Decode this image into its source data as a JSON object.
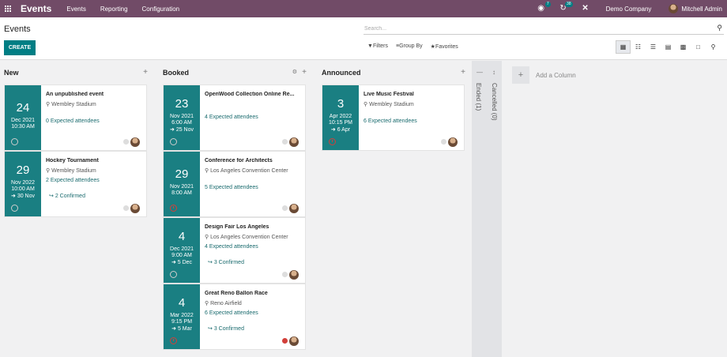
{
  "topbar": {
    "brand": "Events",
    "menu": [
      "Events",
      "Reporting",
      "Configuration"
    ],
    "chat_badge": "7",
    "activity_badge": "38",
    "company": "Demo Company",
    "user": "Mitchell Admin"
  },
  "control": {
    "title": "Events",
    "create_label": "CREATE",
    "search_placeholder": "Search...",
    "filters_label": "Filters",
    "groupby_label": "Group By",
    "favorites_label": "Favorites"
  },
  "columns": [
    {
      "name": "New",
      "cards": [
        {
          "day": "24",
          "month_year": "Dec 2021",
          "time": "10:30 AM",
          "end": "",
          "title": "An unpublished event",
          "location": "Wembley Stadium",
          "attendees": "0 Expected attendees",
          "confirmed": "",
          "clock": "grey",
          "dot": "grey"
        },
        {
          "day": "29",
          "month_year": "Nov 2022",
          "time": "10:00 AM",
          "end": "30 Nov",
          "title": "Hockey Tournament",
          "location": "Wembley Stadium",
          "attendees": "2 Expected attendees",
          "confirmed": "2 Confirmed",
          "clock": "grey",
          "dot": "grey"
        }
      ]
    },
    {
      "name": "Booked",
      "cards": [
        {
          "day": "23",
          "month_year": "Nov 2021",
          "time": "6:00 AM",
          "end": "25 Nov",
          "title": "OpenWood Collection Online Re...",
          "location": "",
          "attendees": "4 Expected attendees",
          "confirmed": "",
          "clock": "grey",
          "dot": "grey"
        },
        {
          "day": "29",
          "month_year": "Nov 2021",
          "time": "8:00 AM",
          "end": "",
          "title": "Conference for Architects",
          "location": "Los Angeles Convention Center",
          "attendees": "5 Expected attendees",
          "confirmed": "",
          "clock": "red",
          "dot": "grey"
        },
        {
          "day": "4",
          "month_year": "Dec 2021",
          "time": "9:00 AM",
          "end": "5 Dec",
          "title": "Design Fair Los Angeles",
          "location": "Los Angeles Convention Center",
          "attendees": "4 Expected attendees",
          "confirmed": "3 Confirmed",
          "clock": "grey",
          "dot": "grey"
        },
        {
          "day": "4",
          "month_year": "Mar 2022",
          "time": "9:15 PM",
          "end": "5 Mar",
          "title": "Great Reno Ballon Race",
          "location": "Reno Airfield",
          "attendees": "6 Expected attendees",
          "confirmed": "3 Confirmed",
          "clock": "red",
          "dot": "red"
        }
      ]
    },
    {
      "name": "Announced",
      "cards": [
        {
          "day": "3",
          "month_year": "Apr 2022",
          "time": "10:15 PM",
          "end": "6 Apr",
          "title": "Live Music Festival",
          "location": "Wembley Stadium",
          "attendees": "6 Expected attendees",
          "confirmed": "",
          "clock": "red",
          "dot": "grey"
        }
      ]
    }
  ],
  "folded": [
    "Ended (1)",
    "Cancelled (0)"
  ],
  "add_column_label": "Add a Column",
  "colors": {
    "brand": "#714b67",
    "accent": "#017e84",
    "date_block": "#1a7f82"
  }
}
